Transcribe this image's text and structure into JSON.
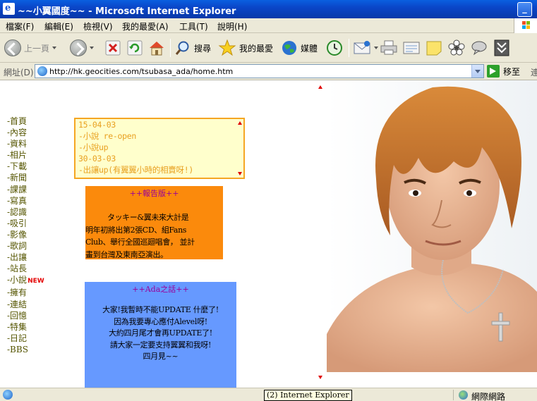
{
  "window": {
    "title": "~~小翼國度~~ - Microsoft Internet Explorer",
    "minimize_label": "_"
  },
  "menu": [
    "檔案(F)",
    "編輯(E)",
    "檢視(V)",
    "我的最愛(A)",
    "工具(T)",
    "說明(H)"
  ],
  "toolbar": {
    "back_label": "上一頁",
    "search_label": "搜尋",
    "favorites_label": "我的最愛",
    "media_label": "媒體"
  },
  "address": {
    "label": "網址(D)",
    "url": "http://hk.geocities.com/tsubasa_ada/home.htm",
    "go_label": "移至",
    "links_cut": "連"
  },
  "nav": {
    "items": [
      "-首頁",
      "-內容",
      "-資料",
      "-相片",
      "-下載",
      "-新聞",
      "-課課",
      "-寫真",
      "-認識",
      "-吸引",
      "-影像",
      "-歌詞",
      "-出讓",
      "-站長",
      "-小說",
      "-擁有",
      "-連結",
      "-回憶",
      "-特集",
      "-日記",
      "-BBS"
    ],
    "new_badge": "NEW"
  },
  "news": {
    "lines": [
      "15-04-03",
      "-小說 re-open",
      "-小說up",
      "30-03-03",
      "-出讓up(有翼翼小時的相賣呀!)"
    ]
  },
  "board": {
    "title": "++報告版++",
    "body": "          タッキー&翼未來大計是\n明年初將出第2張CD、組Fans\nClub、舉行全國巡廻唱會， 並計\n畫到台灣及東南亞演出。"
  },
  "ada": {
    "title": "++Ada之話++",
    "body": "大家!我暫時不能UPDATE 什麼了!\n因為我要專心應付Alevel呀!\n大約四月尾才會再UPDATE了!\n請大家一定要支持翼翼和我呀!\n四月見~~"
  },
  "status": {
    "tooltip": "(2) Internet Explorer",
    "zone": "網際網路"
  },
  "colors": {
    "nav_link": "#555500",
    "news_text": "#e8a020",
    "board_bg": "#fb8a0c",
    "ada_bg": "#6699ff",
    "title_text": "#990099",
    "new_badge": "#e40000"
  }
}
